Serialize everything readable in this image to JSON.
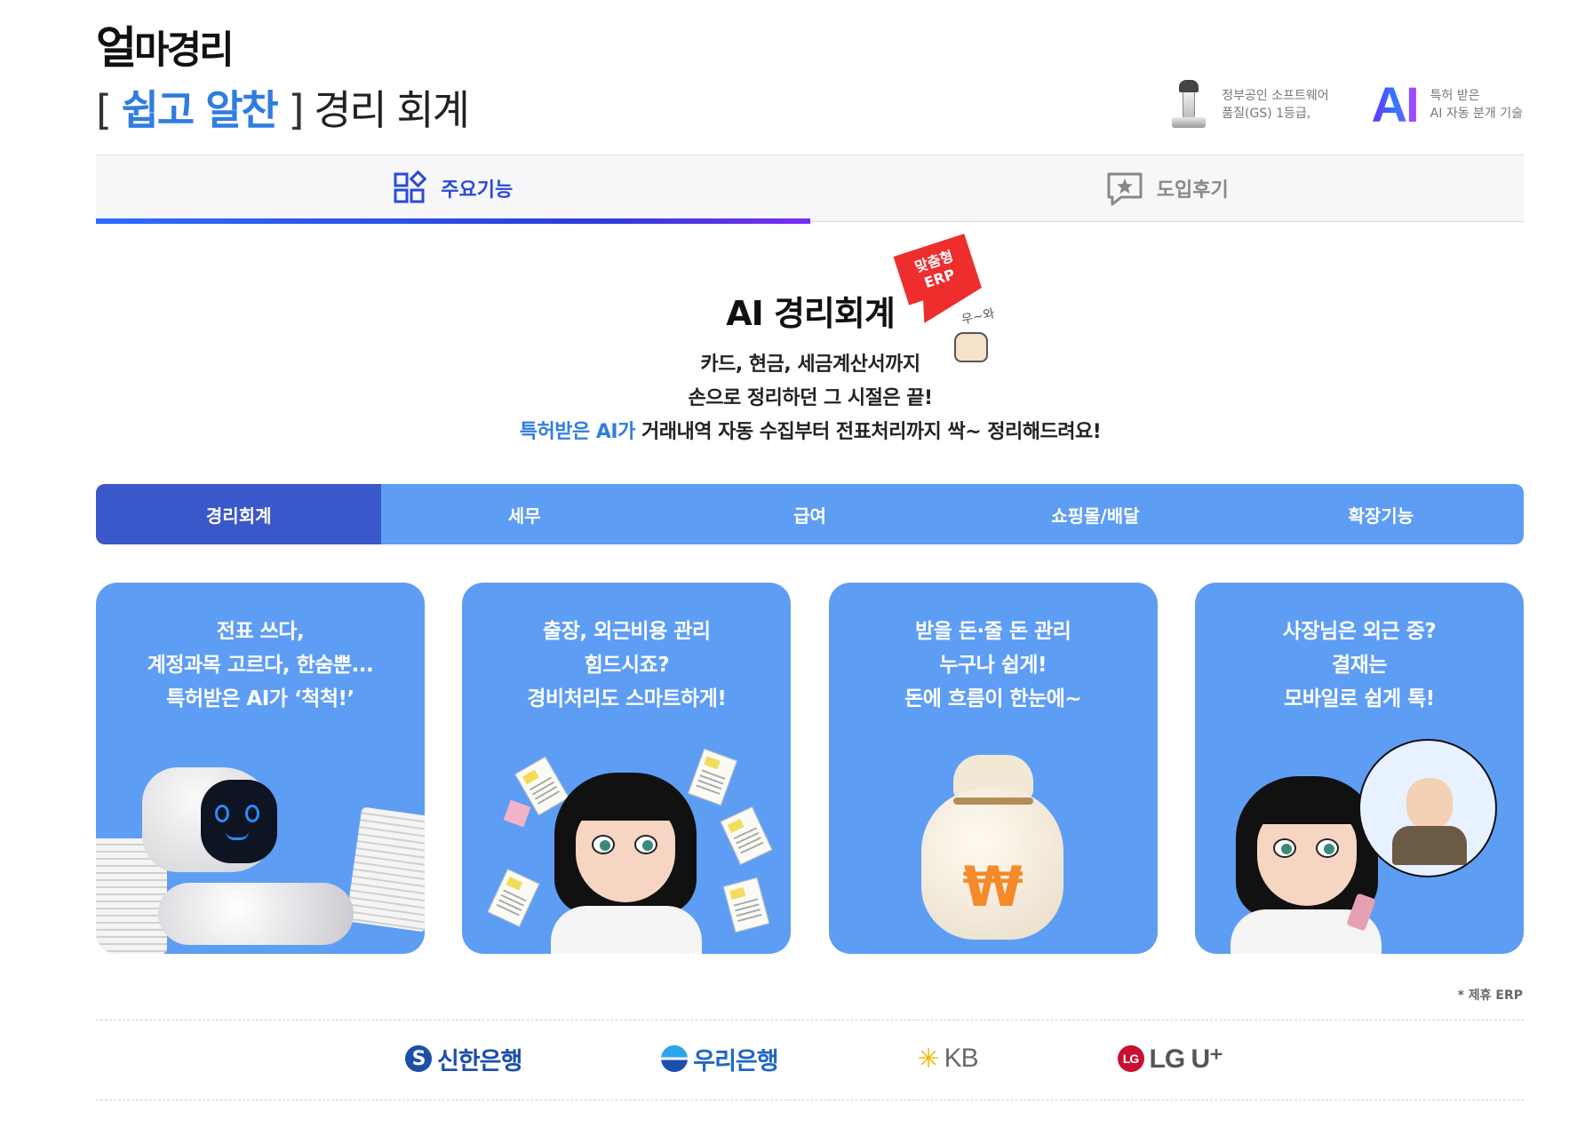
{
  "brand": {
    "logo_big": "얼",
    "logo_rest": "마경리",
    "tagline_open": "[ ",
    "tagline_highlight": "쉽고 알찬",
    "tagline_close": " ]",
    "tagline_rest": " 경리 회계"
  },
  "badges": {
    "gs_line1": "정부공인 소프트웨어",
    "gs_line2": "품질(GS) 1등급,",
    "ai_logo": "AI",
    "ai_line1": "특허 받은",
    "ai_line2": "AI 자동 분개 기술"
  },
  "tabs": [
    {
      "label": "주요기능",
      "icon": "grid-icon",
      "active": true
    },
    {
      "label": "도입후기",
      "icon": "star-chat-icon",
      "active": false
    }
  ],
  "intro": {
    "title": "AI 경리회계",
    "sticker": "맞춤형 ERP",
    "wow": "우~와",
    "line1": "카드, 현금, 세금계산서까지",
    "line2": "손으로 정리하던 그 시절은 끝!",
    "line3_highlight": "특허받은 AI가",
    "line3_rest": " 거래내역 자동 수집부터 전표처리까지 싹~ 정리해드려요!"
  },
  "categories": [
    {
      "label": "경리회계",
      "active": true
    },
    {
      "label": "세무",
      "active": false
    },
    {
      "label": "급여",
      "active": false
    },
    {
      "label": "쇼핑몰/배달",
      "active": false
    },
    {
      "label": "확장기능",
      "active": false
    }
  ],
  "cards": [
    {
      "lines": [
        "전표 쓰다,",
        "계정과목 고르다, 한숨뿐...",
        "특허받은 AI가 ‘척척!’"
      ]
    },
    {
      "lines": [
        "출장, 외근비용 관리",
        "힘드시죠?",
        "경비처리도 스마트하게!"
      ]
    },
    {
      "lines": [
        "받을 돈·줄 돈 관리",
        "누구나 쉽게!",
        "돈에 흐름이 한눈에~"
      ]
    },
    {
      "lines": [
        "사장님은 외근 중?",
        "결재는",
        "모바일로 쉽게 톡!"
      ]
    }
  ],
  "footer": {
    "note": "* 제휴 ERP",
    "partners": [
      "신한은행",
      "우리은행",
      "KB",
      "LG U⁺"
    ]
  },
  "colors": {
    "accent_blue": "#2f7de1",
    "tab_active": "#2a4ad8",
    "category_bg": "#5e9df4",
    "category_active": "#3a58c9",
    "card_bg": "#5e9df4",
    "sticker_red": "#ee2d2d"
  }
}
